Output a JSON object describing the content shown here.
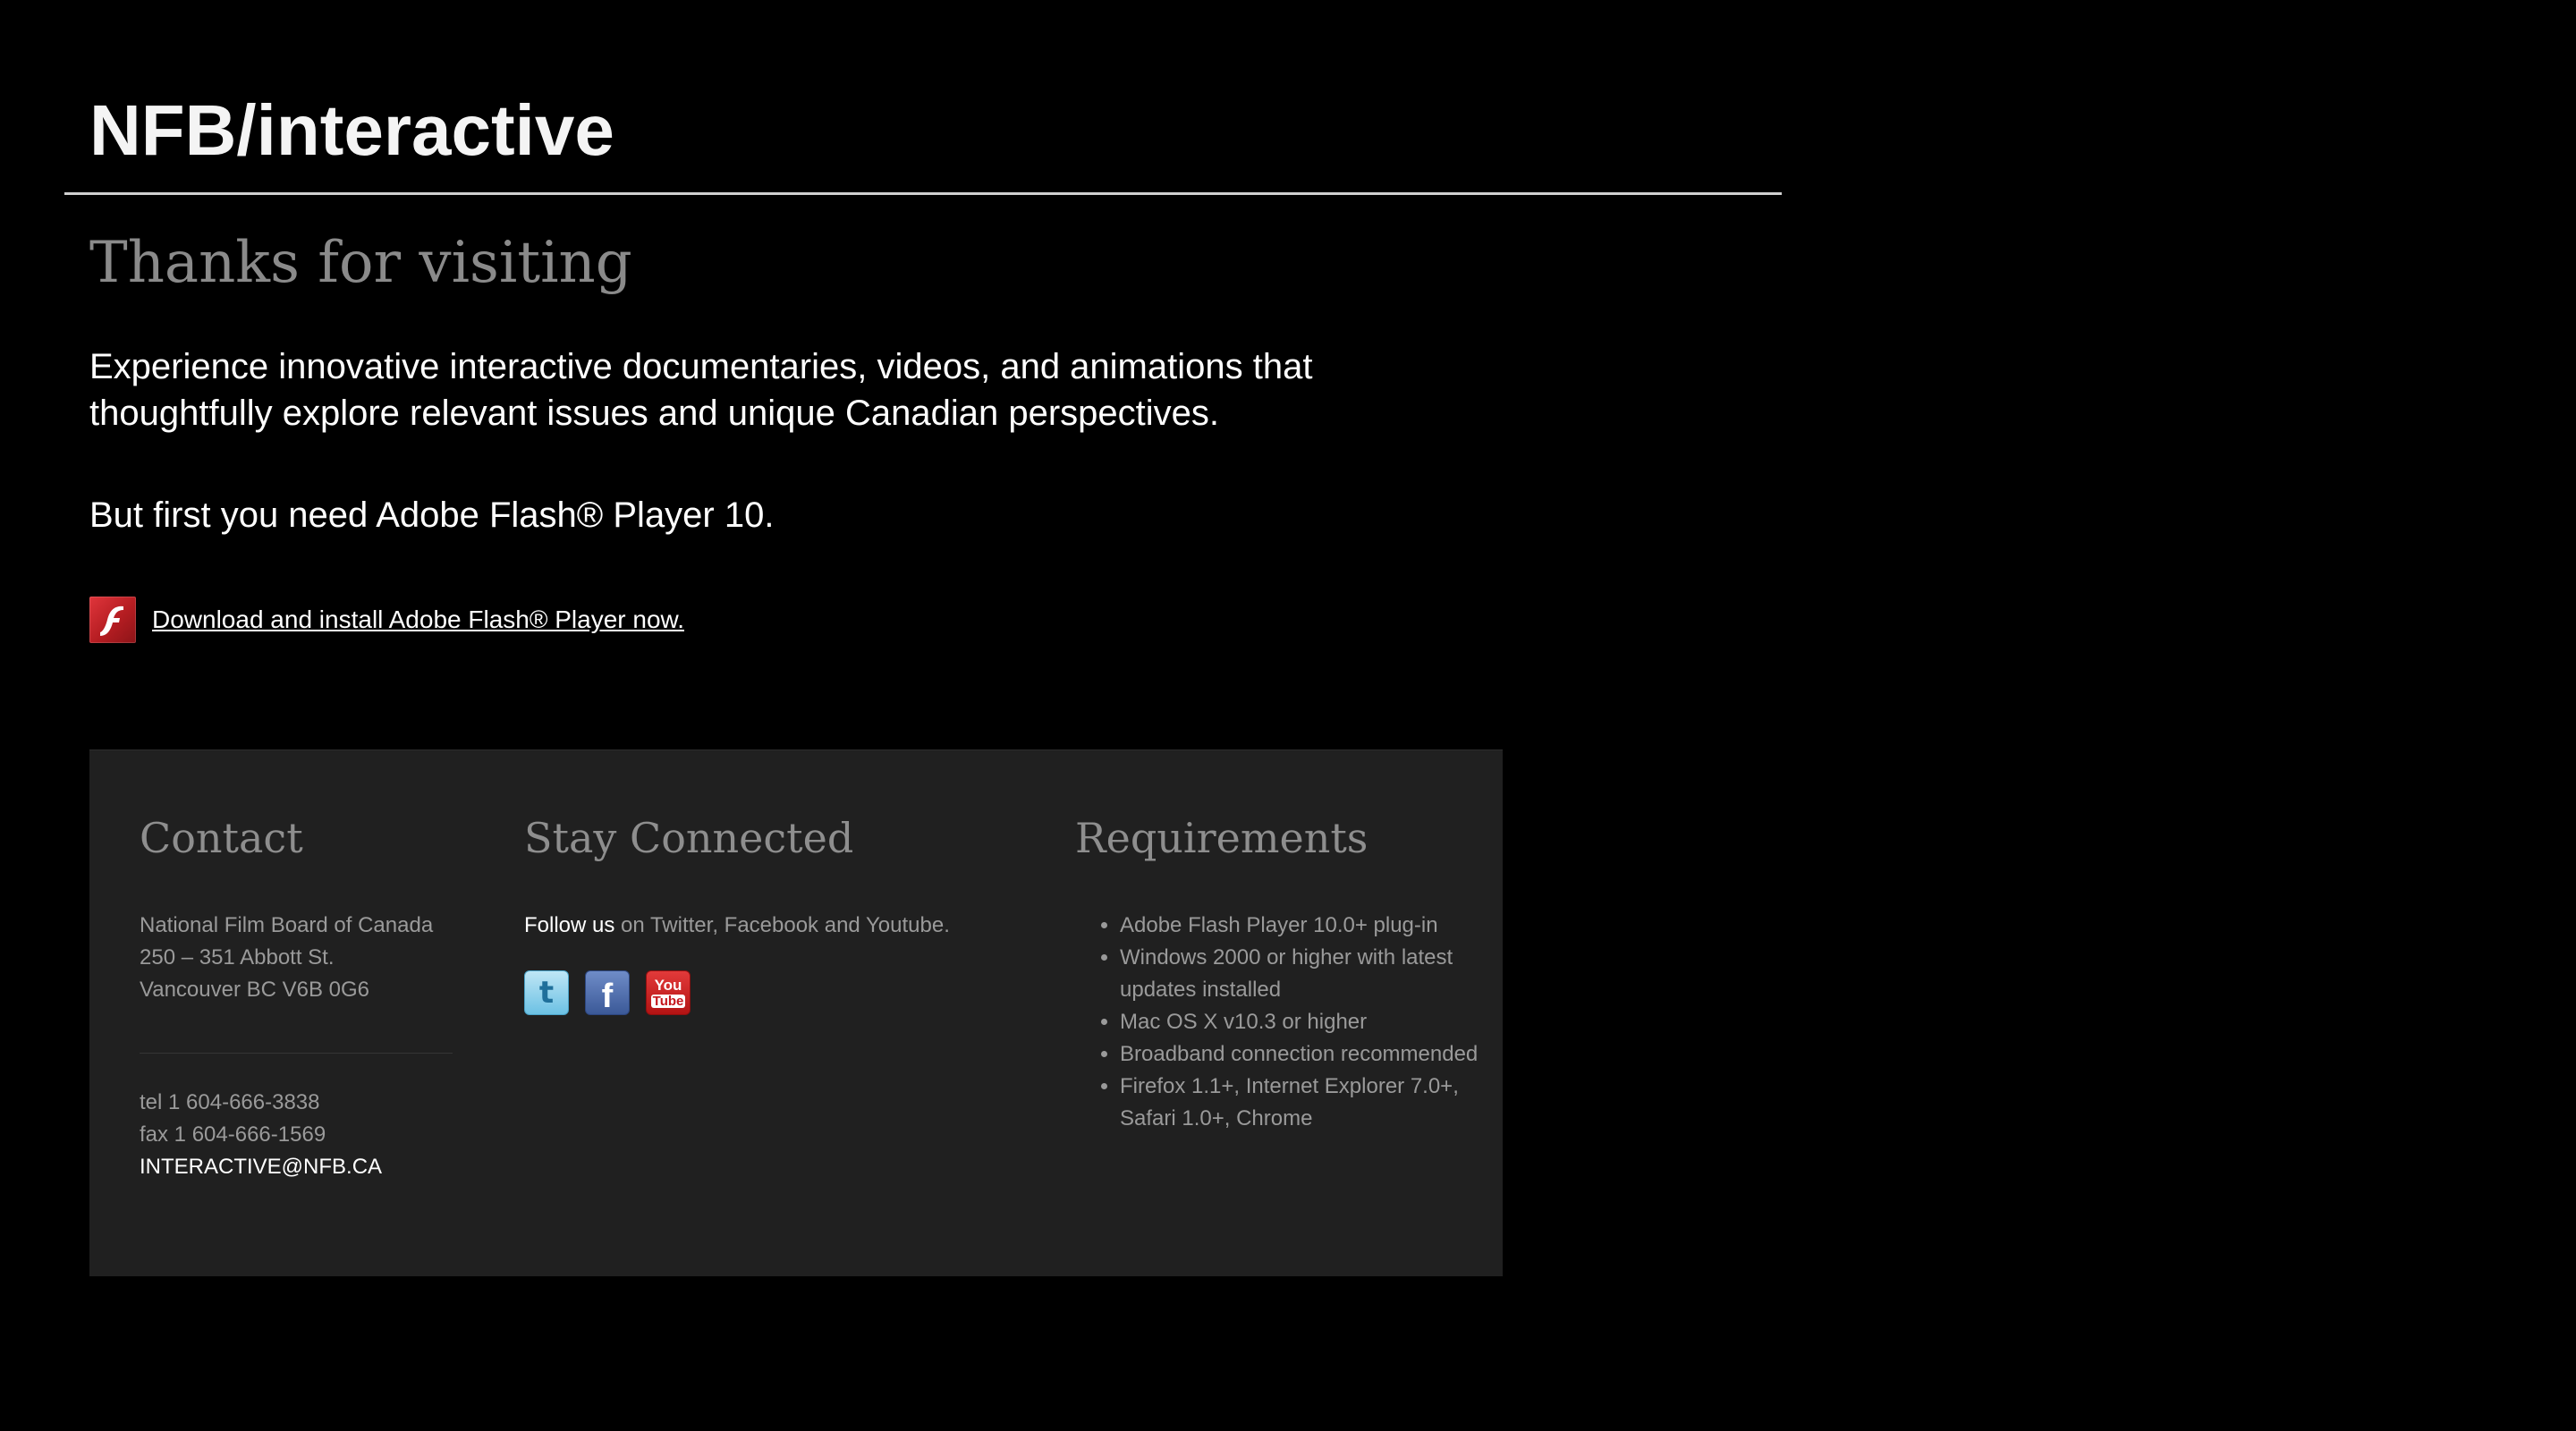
{
  "header": {
    "site_title": "NFB/interactive"
  },
  "main": {
    "heading": "Thanks for visiting",
    "intro": "Experience innovative interactive documentaries, videos, and animations that thoughtfully explore relevant issues and unique Canadian perspectives.",
    "flash_requirement": "But first you need Adobe Flash® Player 10.",
    "download_link": "Download and install Adobe Flash® Player now.",
    "flash_icon_glyph": "f"
  },
  "footer": {
    "contact": {
      "heading": "Contact",
      "address_lines": [
        "National Film Board of Canada",
        "250 – 351 Abbott St.",
        "Vancouver BC V6B 0G6"
      ],
      "tel": "tel 1 604-666-3838",
      "fax": "fax 1 604-666-1569",
      "email": "INTERACTIVE@NFB.CA"
    },
    "stay_connected": {
      "heading": "Stay Connected",
      "follow_label": "Follow us",
      "follow_rest": " on Twitter, Facebook and Youtube.",
      "social": {
        "twitter_glyph": "t",
        "facebook_glyph": "f",
        "youtube_top": "You",
        "youtube_bottom": "Tube"
      }
    },
    "requirements": {
      "heading": "Requirements",
      "items": [
        "Adobe Flash Player 10.0+ plug-in",
        "Windows 2000 or higher with latest updates installed",
        "Mac OS X v10.3 or higher",
        "Broadband connection recommended",
        "Firefox 1.1+, Internet Explorer 7.0+, Safari 1.0+, Chrome"
      ]
    }
  },
  "colors": {
    "background": "#000000",
    "panel": "#202020",
    "muted_text": "#9a9a9a",
    "heading_gray": "#8e8e8e",
    "flash_red": "#c4161c"
  }
}
